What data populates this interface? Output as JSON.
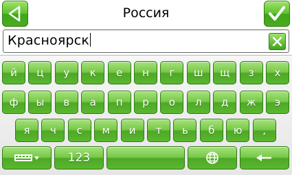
{
  "header": {
    "title": "Россия",
    "back_icon": "back-arrow-icon",
    "ok_icon": "checkmark-icon"
  },
  "input": {
    "value": "Красноярск",
    "clear_icon": "clear-x-icon"
  },
  "keyboard": {
    "row1": [
      "й",
      "ц",
      "у",
      "к",
      "е",
      "н",
      "г",
      "ш",
      "щ",
      "з",
      "х"
    ],
    "row2": [
      "ф",
      "ы",
      "в",
      "а",
      "п",
      "р",
      "о",
      "л",
      "д",
      "ж",
      "э"
    ],
    "row3": [
      "я",
      "ч",
      "с",
      "м",
      "и",
      "т",
      "ь",
      "б",
      "ю",
      ","
    ],
    "bottom": {
      "layout_icon": "keyboard-layout-icon",
      "numbers_label": "123",
      "space_label": "",
      "globe_icon": "globe-icon",
      "backspace_icon": "backspace-arrow-icon"
    }
  },
  "colors": {
    "key_green": "#5ab72e",
    "key_border": "#2f7a15",
    "key_text": "#ffffff"
  }
}
